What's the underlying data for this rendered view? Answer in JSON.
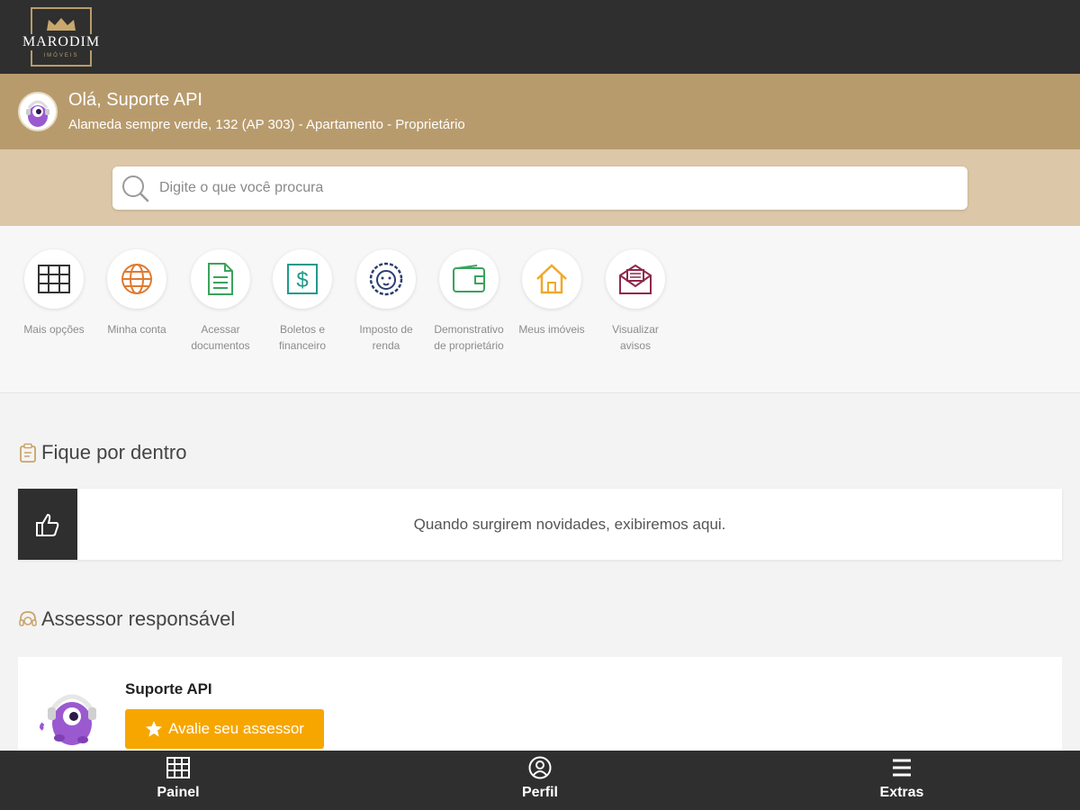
{
  "brand": {
    "name": "MARODIM",
    "sub": "IMÓVEIS"
  },
  "user": {
    "greeting": "Olá, Suporte API",
    "address": "Alameda sempre verde, 132 (AP 303) - Apartamento - Proprietário"
  },
  "search": {
    "placeholder": "Digite o que você procura"
  },
  "shortcuts": [
    {
      "label": "Mais opções",
      "icon": "grid-icon",
      "color": "#333333"
    },
    {
      "label": "Minha conta",
      "icon": "globe-icon",
      "color": "#e07a2e"
    },
    {
      "label": "Acessar documentos",
      "icon": "document-icon",
      "color": "#3aa35b"
    },
    {
      "label": "Boletos e financeiro",
      "icon": "dollar-icon",
      "color": "#1f9a8a"
    },
    {
      "label": "Imposto de renda",
      "icon": "lion-icon",
      "color": "#2c3e70"
    },
    {
      "label": "Demonstrativo de proprietário",
      "icon": "wallet-icon",
      "color": "#3aa35b"
    },
    {
      "label": "Meus imóveis",
      "icon": "house-icon",
      "color": "#f0a92a"
    },
    {
      "label": "Visualizar avisos",
      "icon": "envelope-icon",
      "color": "#8e2a4a"
    }
  ],
  "news": {
    "title": "Fique por dentro",
    "empty_text": "Quando surgirem novidades, exibiremos aqui."
  },
  "advisor": {
    "title": "Assessor responsável",
    "name": "Suporte API",
    "rate_label": "Avalie seu assessor"
  },
  "nav": [
    {
      "label": "Painel",
      "icon": "grid-icon"
    },
    {
      "label": "Perfil",
      "icon": "user-circle-icon"
    },
    {
      "label": "Extras",
      "icon": "menu-icon"
    }
  ],
  "colors": {
    "dark": "#2f2f2f",
    "gold": "#b89b6d",
    "sand": "#dcc8a8",
    "accent": "#f7a600"
  }
}
